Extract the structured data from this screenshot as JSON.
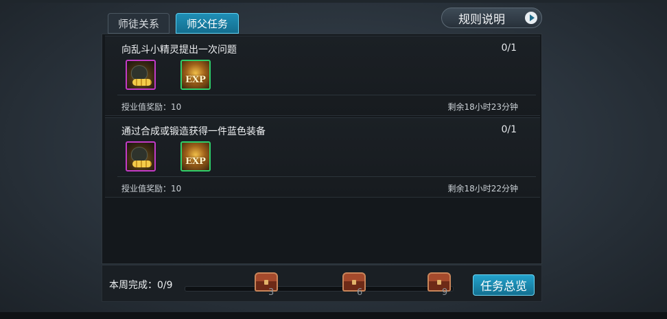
{
  "tabs": [
    {
      "label": "师徒关系",
      "active": false
    },
    {
      "label": "师父任务",
      "active": true
    }
  ],
  "rules_button": {
    "label": "规则说明",
    "icon": "play-arrow-icon"
  },
  "tasks": [
    {
      "title": "向乱斗小精灵提出一次问题",
      "progress": "0/1",
      "reward": "授业值奖励：10",
      "remaining": "剩余18小时23分钟",
      "items": [
        {
          "icon": "gold-coins-icon",
          "rarity_color": "#c43bc8"
        },
        {
          "icon": "exp-icon",
          "label": "EXP",
          "rarity_color": "#2fcf6a"
        }
      ]
    },
    {
      "title": "通过合成或锻造获得一件蓝色装备",
      "progress": "0/1",
      "reward": "授业值奖励：10",
      "remaining": "剩余18小时22分钟",
      "items": [
        {
          "icon": "gold-coins-icon",
          "rarity_color": "#c43bc8"
        },
        {
          "icon": "exp-icon",
          "label": "EXP",
          "rarity_color": "#2fcf6a"
        }
      ]
    }
  ],
  "footer": {
    "week_label": "本周完成：0/9",
    "chests": [
      {
        "threshold": "3"
      },
      {
        "threshold": "6"
      },
      {
        "threshold": "9"
      }
    ],
    "overview_button": "任务总览"
  },
  "colors": {
    "accent_tab": "#1f8fb6",
    "button_blue": "#23a2cc",
    "panel_bg": "#14181c"
  }
}
